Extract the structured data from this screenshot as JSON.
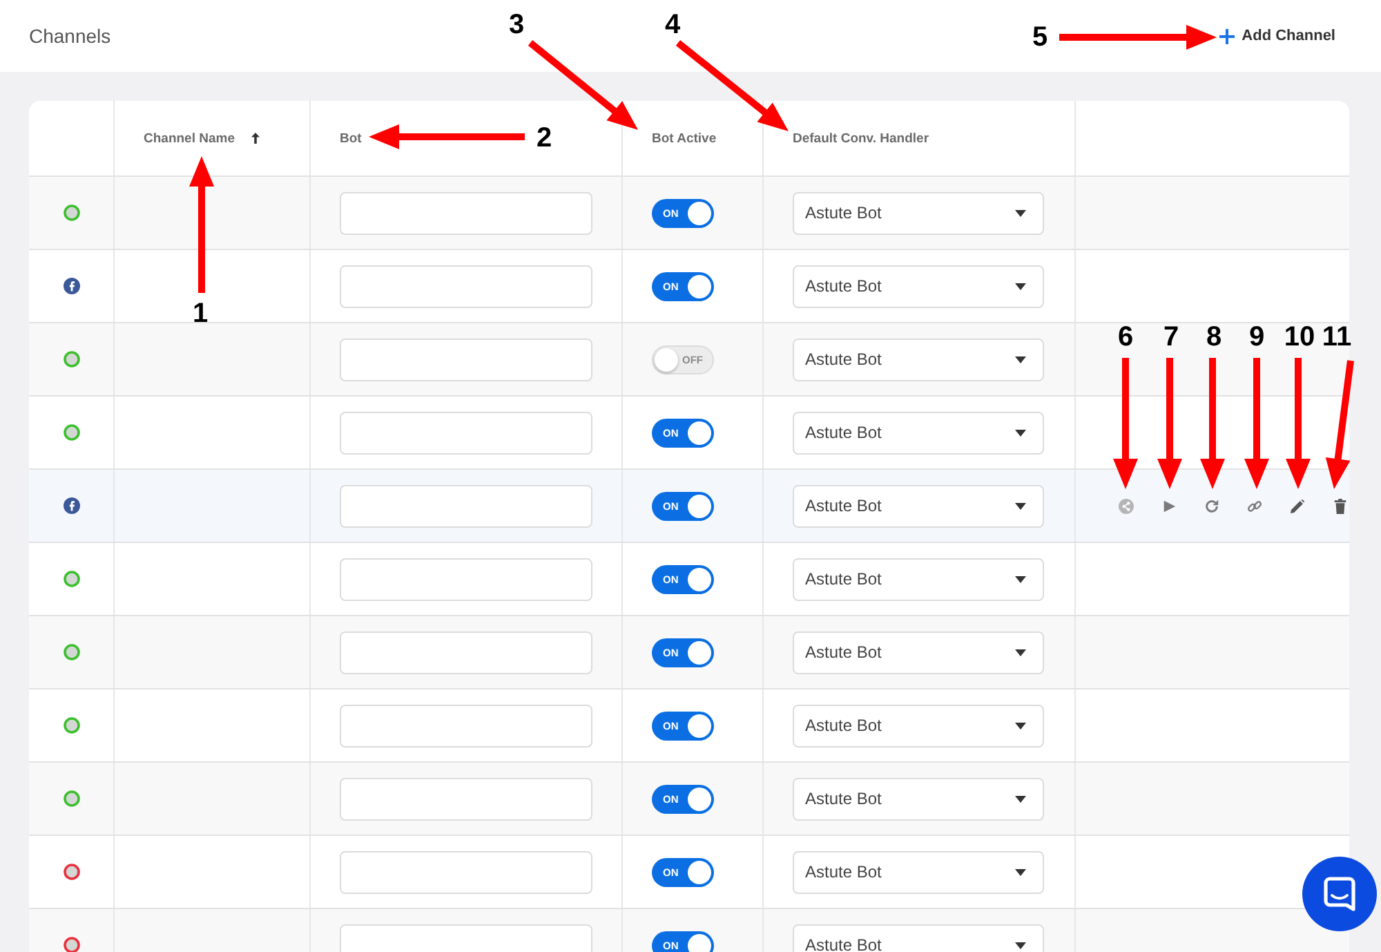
{
  "header": {
    "title": "Channels",
    "add_button": "Add Channel"
  },
  "table": {
    "columns": [
      {
        "label": "Channel Name",
        "sorted": true
      },
      {
        "label": "Bot",
        "sorted": false
      },
      {
        "label": "Bot Active",
        "sorted": false
      },
      {
        "label": "Default Conv. Handler",
        "sorted": false
      }
    ],
    "rows": [
      {
        "kind": "web",
        "color": "#3cbf2e",
        "bot_active": {
          "on": true,
          "label": "ON"
        },
        "handler": "Astute Bot",
        "hovered": false
      },
      {
        "kind": "facebook",
        "color": "#3b5998",
        "bot_active": {
          "on": true,
          "label": "ON"
        },
        "handler": "Astute Bot",
        "hovered": false
      },
      {
        "kind": "web",
        "color": "#3cbf2e",
        "bot_active": {
          "on": false,
          "label": "OFF"
        },
        "handler": "Astute Bot",
        "hovered": false
      },
      {
        "kind": "web",
        "color": "#3cbf2e",
        "bot_active": {
          "on": true,
          "label": "ON"
        },
        "handler": "Astute Bot",
        "hovered": false
      },
      {
        "kind": "facebook",
        "color": "#3b5998",
        "bot_active": {
          "on": true,
          "label": "ON"
        },
        "handler": "Astute Bot",
        "hovered": true
      },
      {
        "kind": "web",
        "color": "#3cbf2e",
        "bot_active": {
          "on": true,
          "label": "ON"
        },
        "handler": "Astute Bot",
        "hovered": false
      },
      {
        "kind": "web",
        "color": "#3cbf2e",
        "bot_active": {
          "on": true,
          "label": "ON"
        },
        "handler": "Astute Bot",
        "hovered": false
      },
      {
        "kind": "web",
        "color": "#3cbf2e",
        "bot_active": {
          "on": true,
          "label": "ON"
        },
        "handler": "Astute Bot",
        "hovered": false
      },
      {
        "kind": "web",
        "color": "#3cbf2e",
        "bot_active": {
          "on": true,
          "label": "ON"
        },
        "handler": "Astute Bot",
        "hovered": false
      },
      {
        "kind": "web",
        "color": "#e8323f",
        "bot_active": {
          "on": true,
          "label": "ON"
        },
        "handler": "Astute Bot",
        "hovered": false
      },
      {
        "kind": "web",
        "color": "#e8323f",
        "bot_active": {
          "on": true,
          "label": "ON"
        },
        "handler": "Astute Bot",
        "hovered": false
      }
    ]
  },
  "annotations": [
    {
      "label": "1"
    },
    {
      "label": "2"
    },
    {
      "label": "3"
    },
    {
      "label": "4"
    },
    {
      "label": "5"
    },
    {
      "label": "6"
    },
    {
      "label": "7"
    },
    {
      "label": "8"
    },
    {
      "label": "9"
    },
    {
      "label": "10"
    },
    {
      "label": "11"
    }
  ]
}
